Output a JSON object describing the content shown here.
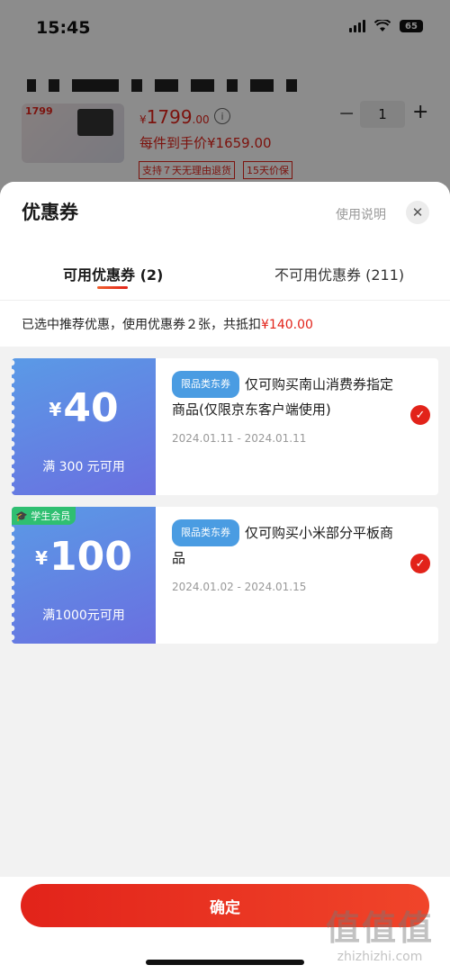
{
  "status_bar": {
    "time": "15:45",
    "battery": "65"
  },
  "product": {
    "thumb_price": "1799",
    "price_yen": "¥",
    "price_main": "1799",
    "price_decimal": ".00",
    "quantity": "1",
    "hand_price": "每件到手价¥1659.00",
    "tag_return": "支持７天无理由退货",
    "tag_warranty": "15天价保"
  },
  "sheet": {
    "title": "优惠券",
    "help_label": "使用说明",
    "close_label": "✕",
    "tab_available": "可用优惠券 (2)",
    "tab_unavailable": "不可用优惠券 (211)",
    "summary_prefix": "已选中推荐优惠，使用优惠券２张，共抵扣",
    "summary_amount": "¥140.00"
  },
  "coupons": [
    {
      "yen": "¥",
      "amount": "40",
      "condition": "满 300 元可用",
      "category": "限品类东券",
      "description": "仅可购买南山消费券指定商品(仅限京东客户端使用)",
      "dates": "2024.01.11 - 2024.01.11",
      "selected": true
    },
    {
      "badge": "学生会员",
      "yen": "¥",
      "amount": "100",
      "condition": "满1000元可用",
      "category": "限品类东券",
      "description": "仅可购买小米部分平板商品",
      "dates": "2024.01.02 - 2024.01.15",
      "selected": true
    }
  ],
  "footer": {
    "confirm_label": "确定"
  },
  "watermark": {
    "big": "值值值",
    "small": "zhizhizhi.com"
  },
  "colors": {
    "accent_red": "#e2231a",
    "coupon_blue": "#5a9ae6",
    "coupon_purple": "#6a6fe0",
    "student_green": "#2fbf71"
  }
}
